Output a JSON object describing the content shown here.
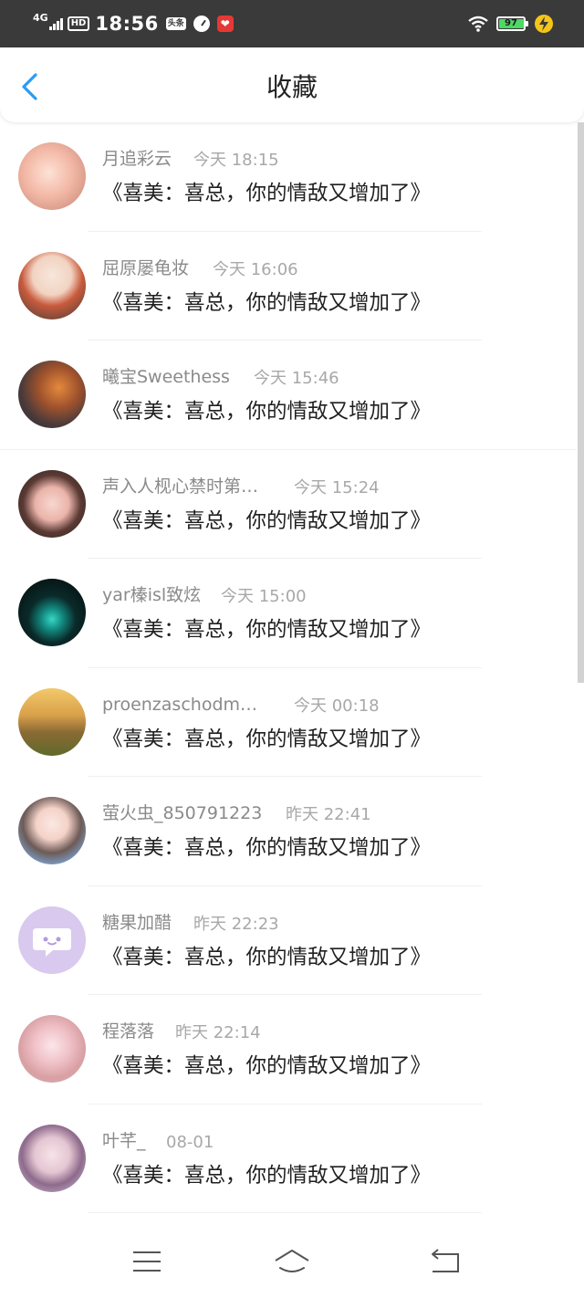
{
  "status_bar": {
    "network": "4G",
    "hd": "HD",
    "time": "18:56",
    "news_badge": "头条",
    "battery_level": "97",
    "icons": [
      "signal-icon",
      "speed-icon",
      "app-icon",
      "wifi-icon",
      "battery-icon",
      "charging-icon"
    ]
  },
  "header": {
    "title": "收藏",
    "back_icon": "chevron-left-icon",
    "accent_color": "#2c9cf0"
  },
  "items": [
    {
      "name": "月追彩云",
      "time": "今天 18:15",
      "title": "《喜美：喜总，你的情敌又增加了》"
    },
    {
      "name": "屈原屡龟妆",
      "time": "今天 16:06",
      "title": "《喜美：喜总，你的情敌又增加了》"
    },
    {
      "name": "曦宝Sweethess",
      "time": "今天 15:46",
      "title": "《喜美：喜总，你的情敌又增加了》"
    },
    {
      "name": "声入人枧心禁时第…",
      "time": "今天 15:24",
      "title": "《喜美：喜总，你的情敌又增加了》"
    },
    {
      "name": "yar榛isl致炫",
      "time": "今天 15:00",
      "title": "《喜美：喜总，你的情敌又增加了》"
    },
    {
      "name": "proenzaschodm…",
      "time": "今天 00:18",
      "title": "《喜美：喜总，你的情敌又增加了》"
    },
    {
      "name": "萤火虫_850791223",
      "time": "昨天 22:41",
      "title": "《喜美：喜总，你的情敌又增加了》"
    },
    {
      "name": "糖果加醋",
      "time": "昨天 22:23",
      "title": "《喜美：喜总，你的情敌又增加了》"
    },
    {
      "name": "程落落",
      "time": "昨天 22:14",
      "title": "《喜美：喜总，你的情敌又增加了》"
    },
    {
      "name": "叶芊_",
      "time": "08-01",
      "title": "《喜美：喜总，你的情敌又增加了》"
    }
  ],
  "nav_bar": {
    "icons": [
      "menu-icon",
      "home-icon",
      "back-icon"
    ]
  }
}
